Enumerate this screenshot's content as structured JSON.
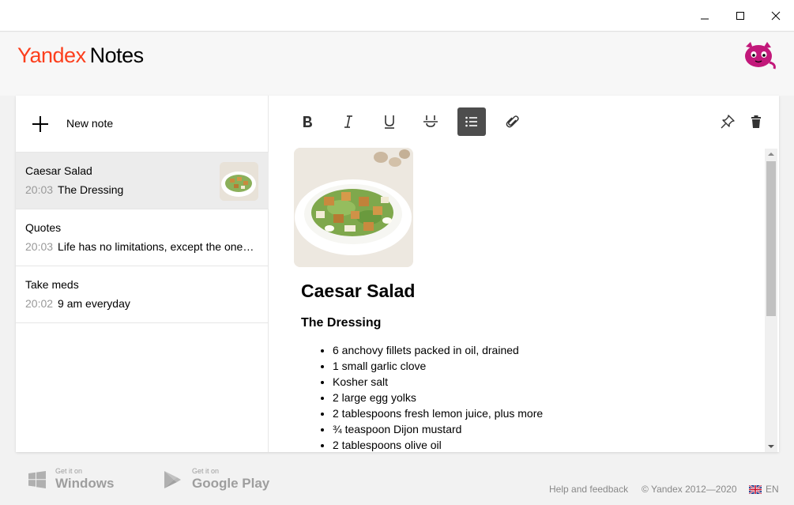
{
  "window": {
    "minimize_icon": "minimize-icon",
    "maximize_icon": "maximize-icon",
    "close_icon": "close-icon"
  },
  "header": {
    "logo_brand": "Yandex",
    "logo_product": "Notes",
    "avatar_icon": "cat-avatar-icon"
  },
  "sidebar": {
    "new_note_label": "New note",
    "notes": [
      {
        "title": "Caesar Salad",
        "time": "20:03",
        "preview": "The Dressing",
        "has_thumbnail": true
      },
      {
        "title": "Quotes",
        "time": "20:03",
        "preview": "Life has no limitations, except the ones you make",
        "has_thumbnail": false
      },
      {
        "title": "Take meds",
        "time": "20:02",
        "preview": "9 am everyday",
        "has_thumbnail": false
      }
    ]
  },
  "toolbar": {
    "buttons": [
      "bold-icon",
      "italic-icon",
      "underline-icon",
      "strikethrough-icon",
      "bulleted-list-icon",
      "attach-icon"
    ],
    "active": "bulleted-list-icon",
    "right_buttons": [
      "pin-icon",
      "trash-icon"
    ]
  },
  "document": {
    "title": "Caesar Salad",
    "subtitle": "The Dressing",
    "items": [
      "6 anchovy fillets packed in oil, drained",
      "1 small garlic clove",
      "Kosher salt",
      "2 large egg yolks",
      "2 tablespoons fresh lemon juice, plus more",
      "¾ teaspoon Dijon mustard",
      "2 tablespoons olive oil"
    ]
  },
  "footer": {
    "windows_small": "Get it on",
    "windows_big": "Windows",
    "gplay_small": "Get it on",
    "gplay_big": "Google Play",
    "help_link": "Help and feedback",
    "copyright": "© Yandex 2012—2020",
    "language": "EN"
  },
  "colors": {
    "brand_red": "#fc3f1d",
    "active_tool_bg": "#4d4d4d",
    "avatar_magenta": "#c2187a"
  }
}
